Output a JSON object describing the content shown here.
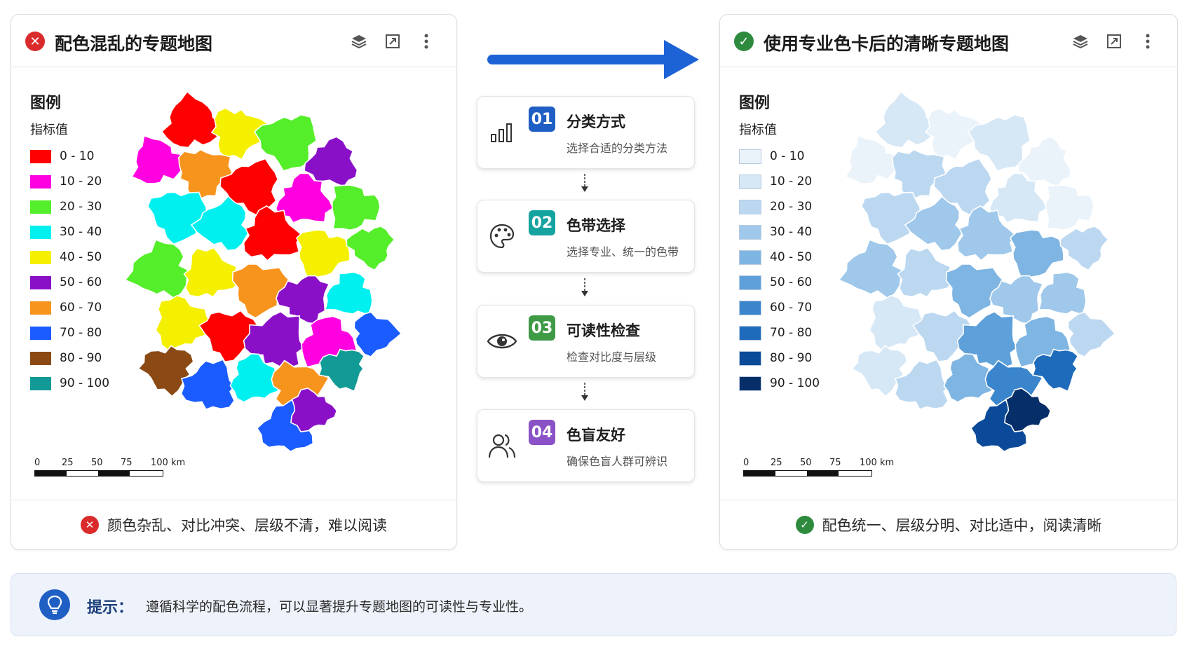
{
  "left_panel": {
    "title": "配色混乱的专题地图",
    "status": "error",
    "legend_title": "图例",
    "legend_subtitle": "指标值",
    "legend": [
      {
        "label": "0 - 10",
        "color": "#ff0000"
      },
      {
        "label": "10 - 20",
        "color": "#ff00e0"
      },
      {
        "label": "20 - 30",
        "color": "#55ee2a"
      },
      {
        "label": "30 - 40",
        "color": "#00f0f0"
      },
      {
        "label": "40 - 50",
        "color": "#f5f000"
      },
      {
        "label": "50 - 60",
        "color": "#8a10c8"
      },
      {
        "label": "60 - 70",
        "color": "#f7941d"
      },
      {
        "label": "70 - 80",
        "color": "#1a5cff"
      },
      {
        "label": "80 - 90",
        "color": "#8b4a14"
      },
      {
        "label": "90 - 100",
        "color": "#129a96"
      }
    ],
    "scale_labels": [
      "0",
      "25",
      "50",
      "75",
      "100 km"
    ],
    "footer_text": "颜色杂乱、对比冲突、层级不清，难以阅读"
  },
  "right_panel": {
    "title": "使用专业色卡后的清晰专题地图",
    "status": "success",
    "legend_title": "图例",
    "legend_subtitle": "指标值",
    "legend": [
      {
        "label": "0 - 10",
        "color": "#eaf2fa"
      },
      {
        "label": "10 - 20",
        "color": "#d6e7f6"
      },
      {
        "label": "20 - 30",
        "color": "#bcd8f1"
      },
      {
        "label": "30 - 40",
        "color": "#9fc8ea"
      },
      {
        "label": "40 - 50",
        "color": "#7fb5e2"
      },
      {
        "label": "50 - 60",
        "color": "#5ea0d9"
      },
      {
        "label": "60 - 70",
        "color": "#3b85cc"
      },
      {
        "label": "70 - 80",
        "color": "#1f6bbb"
      },
      {
        "label": "80 - 90",
        "color": "#0b4a98"
      },
      {
        "label": "90 - 100",
        "color": "#062f6a"
      }
    ],
    "scale_labels": [
      "0",
      "25",
      "50",
      "75",
      "100 km"
    ],
    "footer_text": "配色统一、层级分明、对比适中，阅读清晰"
  },
  "header_icons": [
    "layers-icon",
    "expand-icon",
    "more-vertical-icon"
  ],
  "steps": [
    {
      "num": "01",
      "title": "分类方式",
      "desc": "选择合适的分类方法",
      "icon": "bar-chart-icon",
      "color": "#1f5fc4"
    },
    {
      "num": "02",
      "title": "色带选择",
      "desc": "选择专业、统一的色带",
      "icon": "palette-icon",
      "color": "#15a3a0"
    },
    {
      "num": "03",
      "title": "可读性检查",
      "desc": "检查对比度与层级",
      "icon": "eye-icon",
      "color": "#3f9a46"
    },
    {
      "num": "04",
      "title": "色盲友好",
      "desc": "确保色盲人群可辨识",
      "icon": "users-icon",
      "color": "#8a52c6"
    }
  ],
  "tip": {
    "label": "提示：",
    "text": "遵循科学的配色流程，可以显著提升专题地图的可读性与专业性。"
  },
  "colors": {
    "arrow": "#1e63d6",
    "error": "#d92b2b",
    "success": "#2e8b3e"
  }
}
